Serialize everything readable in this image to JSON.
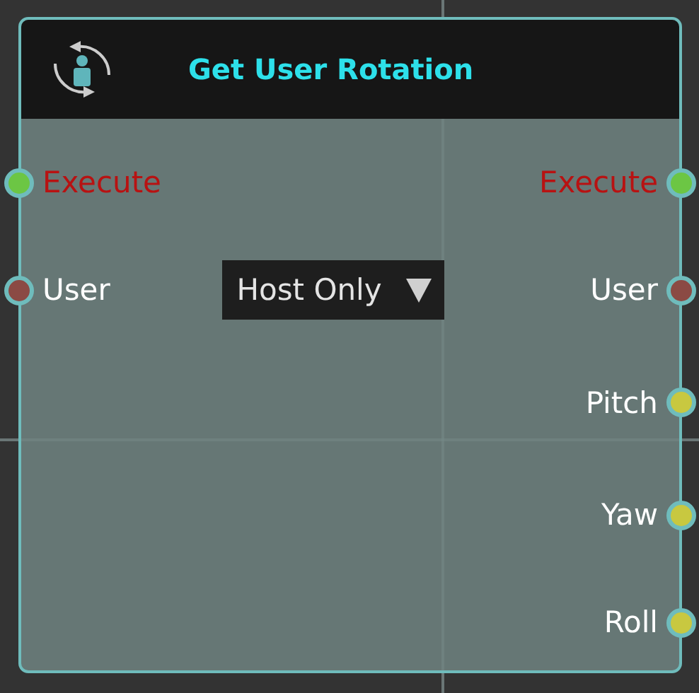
{
  "node": {
    "title": "Get User Rotation",
    "inputs": [
      {
        "label": "Execute",
        "kind": "exec",
        "color": "#6cc644"
      },
      {
        "label": "User",
        "kind": "data",
        "color": "#8b4a44"
      }
    ],
    "dropdown": {
      "value": "Host Only"
    },
    "outputs": [
      {
        "label": "Execute",
        "kind": "exec",
        "color": "#6cc644"
      },
      {
        "label": "User",
        "kind": "data",
        "color": "#8b4a44"
      },
      {
        "label": "Pitch",
        "kind": "data",
        "color": "#c8c840"
      },
      {
        "label": "Yaw",
        "kind": "data",
        "color": "#c8c840"
      },
      {
        "label": "Roll",
        "kind": "data",
        "color": "#c8c840"
      }
    ]
  }
}
